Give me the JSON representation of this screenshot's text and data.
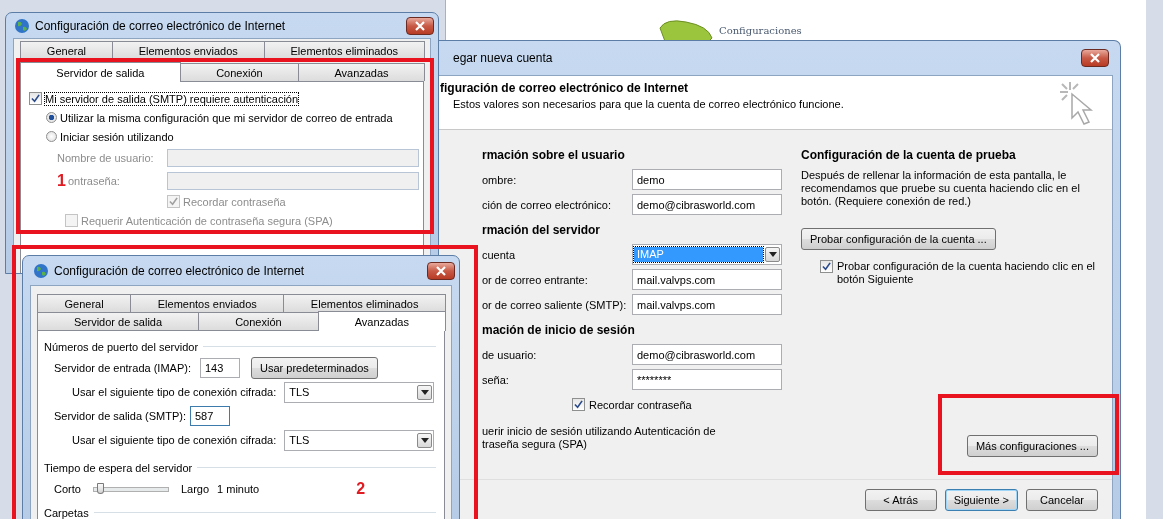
{
  "background_app": {
    "heading": "Configuraciones"
  },
  "account_window": {
    "title": "egar nueva cuenta",
    "header_title": "figuración de correo electrónico de Internet",
    "header_subtitle": "Estos valores son necesarios para que la cuenta de correo electrónico funcione.",
    "sections": [
      {
        "heading": "rmación sobre el usuario",
        "fields": [
          {
            "kind": "text",
            "label": "ombre:",
            "value": "demo"
          },
          {
            "kind": "text",
            "label": "ción de correo electrónico:",
            "value": "demo@cibrasworld.com"
          }
        ]
      },
      {
        "heading": "rmación del servidor",
        "fields": [
          {
            "kind": "select",
            "label": "cuenta",
            "value": "IMAP",
            "highlighted": true
          },
          {
            "kind": "text",
            "label": "or de correo entrante:",
            "value": "mail.valvps.com"
          },
          {
            "kind": "text",
            "label": "or de correo saliente (SMTP):",
            "value": "mail.valvps.com"
          }
        ]
      },
      {
        "heading": "mación de inicio de sesión",
        "fields": [
          {
            "kind": "text",
            "label": "de usuario:",
            "value": "demo@cibrasworld.com"
          },
          {
            "kind": "text",
            "label": "seña:",
            "value": "********"
          }
        ]
      }
    ],
    "remember": {
      "label": "Recordar contraseña",
      "checked": true
    },
    "spa_lines": [
      "uerir inicio de sesión utilizando Autenticación de",
      "traseña segura (SPA)"
    ],
    "test_heading": "Configuración de la cuenta de prueba",
    "test_description": "Después de rellenar la información de esta pantalla, le recomendamos que pruebe su cuenta haciendo clic en el botón. (Requiere conexión de red.)",
    "test_button": "Probar configuración de la cuenta ...",
    "auto_test": {
      "label": "Probar configuración de la cuenta haciendo clic en el botón Siguiente",
      "checked": true
    },
    "more_button": "Más configuraciones ...",
    "buttons": [
      {
        "label": "< Atrás",
        "default": false
      },
      {
        "label": "Siguiente >",
        "default": true
      },
      {
        "label": "Cancelar",
        "default": false
      }
    ]
  },
  "smtp_window": {
    "title": "Configuración de correo electrónico de Internet",
    "tab_rows": [
      [
        {
          "label": "General",
          "selected": false
        },
        {
          "label": "Elementos enviados",
          "selected": false
        },
        {
          "label": "Elementos eliminados",
          "selected": false
        }
      ],
      [
        {
          "label": "Servidor de salida",
          "selected": true
        },
        {
          "label": "Conexión",
          "selected": false
        },
        {
          "label": "Avanzadas",
          "selected": false
        }
      ]
    ],
    "auth_required": {
      "label": "Mi servidor de salida (SMTP) requiere autenticación",
      "checked": true
    },
    "options": [
      {
        "label": "Utilizar la misma configuración que mi servidor de correo de entrada",
        "selected": true
      },
      {
        "label": "Iniciar sesión utilizando",
        "selected": false
      }
    ],
    "fields": [
      {
        "label": "Nombre de usuario:",
        "disabled": true
      },
      {
        "label": "ontraseña:",
        "disabled": true
      }
    ],
    "remember": {
      "label": "Recordar contraseña",
      "checked": true,
      "disabled": true
    },
    "spa": {
      "label": "Requerir Autenticación de contraseña segura (SPA)",
      "checked": false,
      "disabled": true
    },
    "annotation": "1"
  },
  "advanced_window": {
    "title": "Configuración de correo electrónico de Internet",
    "tab_rows": [
      [
        {
          "label": "General",
          "selected": false
        },
        {
          "label": "Elementos enviados",
          "selected": false
        },
        {
          "label": "Elementos eliminados",
          "selected": false
        }
      ],
      [
        {
          "label": "Servidor de salida",
          "selected": false
        },
        {
          "label": "Conexión",
          "selected": false
        },
        {
          "label": "Avanzadas",
          "selected": true
        }
      ]
    ],
    "ports_heading": "Números de puerto del servidor",
    "incoming": {
      "label": "Servidor de entrada (IMAP):",
      "value": "143"
    },
    "defaults_button": "Usar predeterminados",
    "incoming_encryption": {
      "label": "Usar el siguiente tipo de conexión cifrada:",
      "value": "TLS"
    },
    "outgoing": {
      "label": "Servidor de salida (SMTP):",
      "value": "587"
    },
    "outgoing_encryption": {
      "label": "Usar el siguiente tipo de conexión cifrada:",
      "value": "TLS"
    },
    "timeout_heading": "Tiempo de espera del servidor",
    "timeout": {
      "min_label": "Corto",
      "max_label": "Largo",
      "level": 0.08,
      "reading": "1 minuto"
    },
    "folders_heading": "Carpetas",
    "annotation": "2"
  }
}
